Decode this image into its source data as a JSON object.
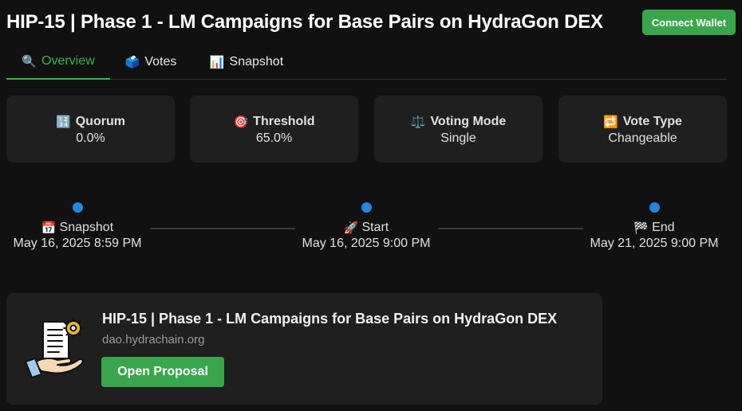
{
  "header": {
    "title": "HIP-15 | Phase 1 - LM Campaigns for Base Pairs on HydraGon DEX",
    "connect_label": "Connect Wallet",
    "accent_color": "#3aa64b"
  },
  "tabs": [
    {
      "icon": "🔍",
      "icon_name": "magnifier-icon",
      "label": "Overview",
      "active": true
    },
    {
      "icon": "🗳️",
      "icon_name": "ballot-box-icon",
      "label": "Votes",
      "active": false
    },
    {
      "icon": "📊",
      "icon_name": "bar-chart-icon",
      "label": "Snapshot",
      "active": false
    }
  ],
  "stats": [
    {
      "icon": "🔢",
      "icon_name": "numbers-icon",
      "title": "Quorum",
      "value": "0.0%"
    },
    {
      "icon": "🎯",
      "icon_name": "target-icon",
      "title": "Threshold",
      "value": "65.0%"
    },
    {
      "icon": "⚖️",
      "icon_name": "scales-icon",
      "title": "Voting Mode",
      "value": "Single"
    },
    {
      "icon": "🔁",
      "icon_name": "repeat-icon",
      "title": "Vote Type",
      "value": "Changeable"
    }
  ],
  "timeline": [
    {
      "icon": "📅",
      "icon_name": "calendar-icon",
      "label": "Snapshot",
      "date": "May 16, 2025 8:59 PM"
    },
    {
      "icon": "🚀",
      "icon_name": "rocket-icon",
      "label": "Start",
      "date": "May 16, 2025 9:00 PM"
    },
    {
      "icon": "🏁",
      "icon_name": "checkered-flag-icon",
      "label": "End",
      "date": "May 21, 2025 9:00 PM"
    }
  ],
  "timeline_dot_color": "#1e88e5",
  "proposal": {
    "illustration_name": "proposal-document-hand-icon",
    "title": "HIP-15 | Phase 1 - LM Campaigns for Base Pairs on HydraGon DEX",
    "domain": "dao.hydrachain.org",
    "button_label": "Open Proposal"
  }
}
